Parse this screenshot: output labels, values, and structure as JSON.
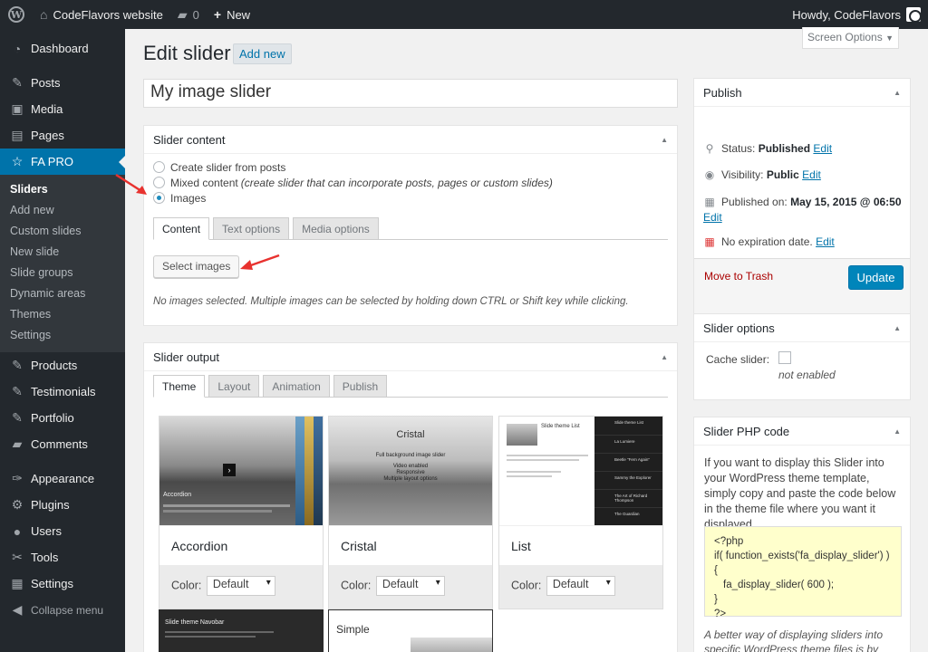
{
  "admin_bar": {
    "site_name": "CodeFlavors website",
    "comments_count": "0",
    "new_label": "New",
    "howdy": "Howdy, CodeFlavors"
  },
  "sidebar": {
    "items_top": [
      {
        "label": "Dashboard",
        "icon": "dashboard-icon"
      }
    ],
    "items_mid": [
      {
        "label": "Posts",
        "icon": "pin-icon"
      },
      {
        "label": "Media",
        "icon": "media-icon"
      },
      {
        "label": "Pages",
        "icon": "pages-icon"
      }
    ],
    "active": {
      "label": "FA PRO",
      "icon": "star-icon"
    },
    "submenu": [
      "Sliders",
      "Add new",
      "Custom slides",
      "New slide",
      "Slide groups",
      "Dynamic areas",
      "Themes",
      "Settings"
    ],
    "items_after": [
      {
        "label": "Products",
        "icon": "pin-icon"
      },
      {
        "label": "Testimonials",
        "icon": "pin-icon"
      },
      {
        "label": "Portfolio",
        "icon": "pin-icon"
      },
      {
        "label": "Comments",
        "icon": "comment-icon"
      }
    ],
    "items_bottom": [
      {
        "label": "Appearance",
        "icon": "brush-icon"
      },
      {
        "label": "Plugins",
        "icon": "plugin-icon"
      },
      {
        "label": "Users",
        "icon": "user-icon"
      },
      {
        "label": "Tools",
        "icon": "wrench-icon"
      },
      {
        "label": "Settings",
        "icon": "settings-icon"
      }
    ],
    "collapse": "Collapse menu"
  },
  "header": {
    "title": "Edit slider",
    "add_new": "Add new",
    "screen_options": "Screen Options"
  },
  "slider_title": "My image slider",
  "slider_content": {
    "heading": "Slider content",
    "options": [
      {
        "label": "Create slider from posts",
        "note": "",
        "checked": false
      },
      {
        "label": "Mixed content",
        "note": "(create slider that can incorporate posts, pages or custom slides)",
        "checked": false
      },
      {
        "label": "Images",
        "note": "",
        "checked": true
      }
    ],
    "tabs": [
      "Content",
      "Text options",
      "Media options"
    ],
    "select_images": "Select images",
    "help": "No images selected. Multiple images can be selected by holding down CTRL or Shift key while clicking."
  },
  "slider_output": {
    "heading": "Slider output",
    "tabs": [
      "Theme",
      "Layout",
      "Animation",
      "Publish"
    ],
    "color_label": "Color:",
    "color_value": "Default",
    "themes": [
      "Accordion",
      "Cristal",
      "List"
    ],
    "previews": {
      "cristal_title": "Cristal",
      "cristal_sub": "Full background image slider",
      "cristal_lines": [
        "Video enabled",
        "Responsive",
        "Multiple layout options"
      ],
      "list_title": "Slide theme List",
      "list_side": [
        "Slide theme List",
        "La Lumiere",
        "Beetle \"Fern Again\"",
        "Sammy the Explorer",
        "The Art of Richard Thompson",
        "The Guardian"
      ],
      "accordion_caption": "Accordion",
      "navobar_title": "Slide theme Navobar",
      "simple_title": "Simple"
    }
  },
  "publish": {
    "heading": "Publish",
    "status_label": "Status:",
    "status_value": "Published",
    "visibility_label": "Visibility:",
    "visibility_value": "Public",
    "published_label": "Published on:",
    "published_value": "May 15, 2015 @ 06:50",
    "expiration": "No expiration date.",
    "edit": "Edit",
    "trash": "Move to Trash",
    "update": "Update"
  },
  "slider_options": {
    "heading": "Slider options",
    "cache_label": "Cache slider:",
    "cache_note": "not enabled"
  },
  "php_code": {
    "heading": "Slider PHP code",
    "intro": "If you want to display this Slider into your WordPress theme template, simply copy and paste the code below in the theme file where you want it displayed.",
    "code_lines": [
      "<?php",
      "if( function_exists('fa_display_slider') ){",
      "fa_display_slider( 600 );",
      "}",
      "?>"
    ],
    "footer": "A better way of displaying sliders into specific WordPress theme files is by using"
  },
  "colors": {
    "admin_bg": "#23282d",
    "accent": "#0073aa",
    "update_button": "#0085ba",
    "arrow": "#e8322f",
    "code_bg": "#ffffcc"
  }
}
